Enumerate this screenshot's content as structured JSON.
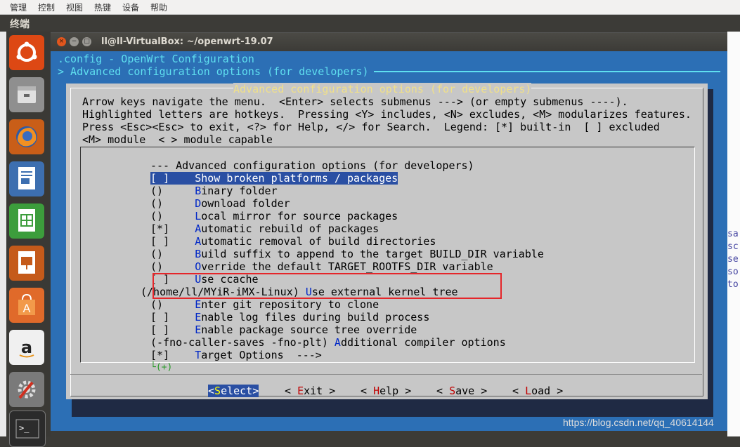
{
  "host_menu": [
    "管理",
    "控制",
    "视图",
    "热键",
    "设备",
    "帮助"
  ],
  "panel_title": "终端",
  "launcher_items": [
    "ubuntu-dash",
    "files",
    "firefox",
    "writer",
    "calc",
    "impress",
    "software-center",
    "amazon",
    "system-settings",
    "terminal"
  ],
  "window": {
    "title": "ll@ll-VirtualBox: ~/openwrt-19.07",
    "close": "×",
    "minimize": "−",
    "maximize": "□"
  },
  "header": {
    "line1": ".config - OpenWrt Configuration",
    "line2": "> Advanced configuration options (for developers)"
  },
  "dialog": {
    "title": "Advanced configuration options (for developers)",
    "help": [
      "Arrow keys navigate the menu.  <Enter> selects submenus ---> (or empty submenus ----).",
      "Highlighted letters are hotkeys.  Pressing <Y> includes, <N> excludes, <M> modularizes features.",
      "Press <Esc><Esc> to exit, <?> for Help, </> for Search.  Legend: [*] built-in  [ ] excluded",
      "<M> module  < > module capable"
    ],
    "menu_header": "--- Advanced configuration options (for developers)",
    "items": [
      {
        "prefix": "[ ]    ",
        "hot": "S",
        "rest": "how broken platforms / packages"
      },
      {
        "prefix": "()     ",
        "hot": "B",
        "rest": "inary folder"
      },
      {
        "prefix": "()     ",
        "hot": "D",
        "rest": "ownload folder"
      },
      {
        "prefix": "()     ",
        "hot": "L",
        "rest": "ocal mirror for source packages"
      },
      {
        "prefix": "[*]    ",
        "hot": "A",
        "rest": "utomatic rebuild of packages"
      },
      {
        "prefix": "[ ]    ",
        "hot": "A",
        "rest": "utomatic removal of build directories"
      },
      {
        "prefix": "()     ",
        "hot": "B",
        "rest": "uild suffix to append to the target BUILD_DIR variable"
      },
      {
        "prefix": "()     ",
        "hot": "O",
        "rest": "verride the default TARGET_ROOTFS_DIR variable"
      },
      {
        "prefix": "[ ]    ",
        "hot": "U",
        "rest": "se ccache"
      },
      {
        "prefix": "(/home/ll/MYiR-iMX-Linux) ",
        "hot": "U",
        "rest": "se external kernel tree"
      },
      {
        "prefix": "()     ",
        "hot": "E",
        "rest": "nter git repository to clone"
      },
      {
        "prefix": "[ ]    ",
        "hot": "E",
        "rest": "nable log files during build process"
      },
      {
        "prefix": "[ ]    ",
        "hot": "E",
        "rest": "nable package source tree override"
      },
      {
        "prefix": "(-fno-caller-saves -fno-plt) ",
        "hot": "A",
        "rest": "dditional compiler options"
      },
      {
        "prefix": "[*]    ",
        "hot": "T",
        "rest": "arget Options  --->"
      }
    ],
    "more": "└(+)",
    "buttons": [
      {
        "pre": "<",
        "hot": "S",
        "rest": "elect>"
      },
      {
        "pre": "< ",
        "hot": "E",
        "rest": "xit >"
      },
      {
        "pre": "< ",
        "hot": "H",
        "rest": "elp >"
      },
      {
        "pre": "< ",
        "hot": "S",
        "rest": "ave >"
      },
      {
        "pre": "< ",
        "hot": "L",
        "rest": "oad >"
      }
    ]
  },
  "right_strip": [
    "sa",
    "sc",
    "se",
    "so",
    "to"
  ],
  "watermark": "https://blog.csdn.net/qq_40614144",
  "colors": {
    "terminal_bg": "#2c6fb5",
    "dialog_bg": "#c7c7c7",
    "highlight": "#2a4fa3",
    "annotation_box": "#e5262a"
  }
}
